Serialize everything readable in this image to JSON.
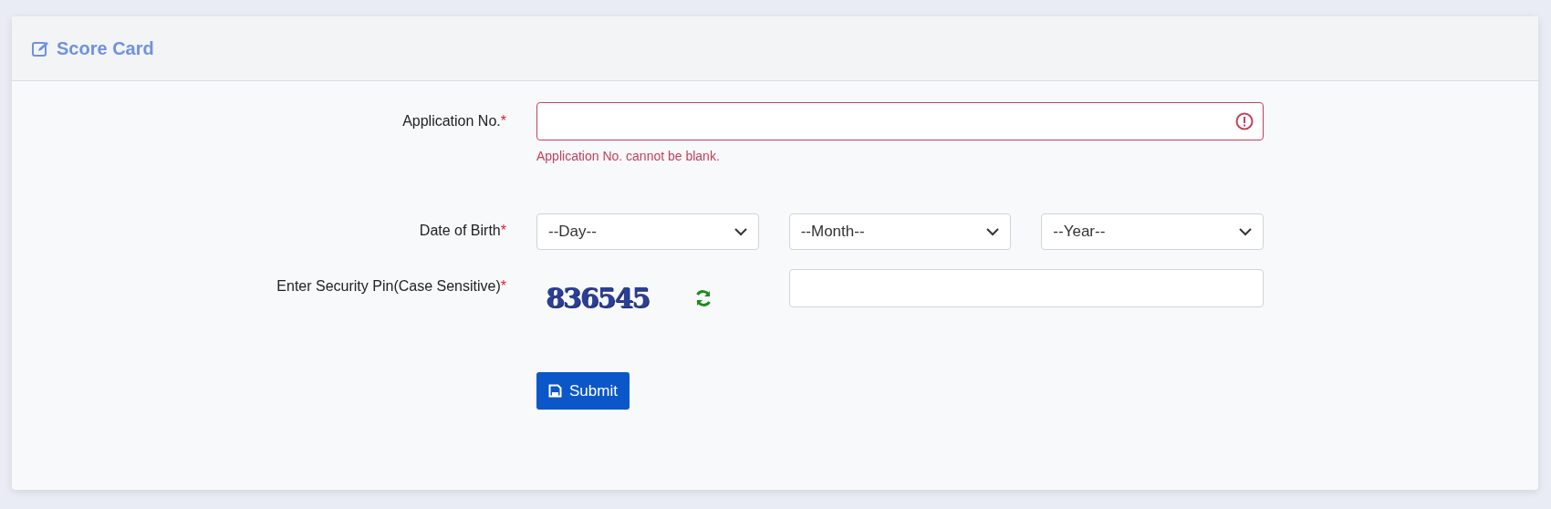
{
  "card": {
    "title": "Score Card"
  },
  "form": {
    "application": {
      "label": "Application No.",
      "required": "*",
      "invalid": true,
      "error": "Application No. cannot be blank."
    },
    "dob": {
      "label": "Date of Birth",
      "required": "*",
      "selects": [
        {
          "value": "--Day--"
        },
        {
          "value": "--Month--"
        },
        {
          "value": "--Year--"
        }
      ]
    },
    "pin": {
      "label": "Enter Security Pin(Case Sensitive)",
      "required": "*",
      "captcha": "836545"
    },
    "submit": "Submit"
  }
}
